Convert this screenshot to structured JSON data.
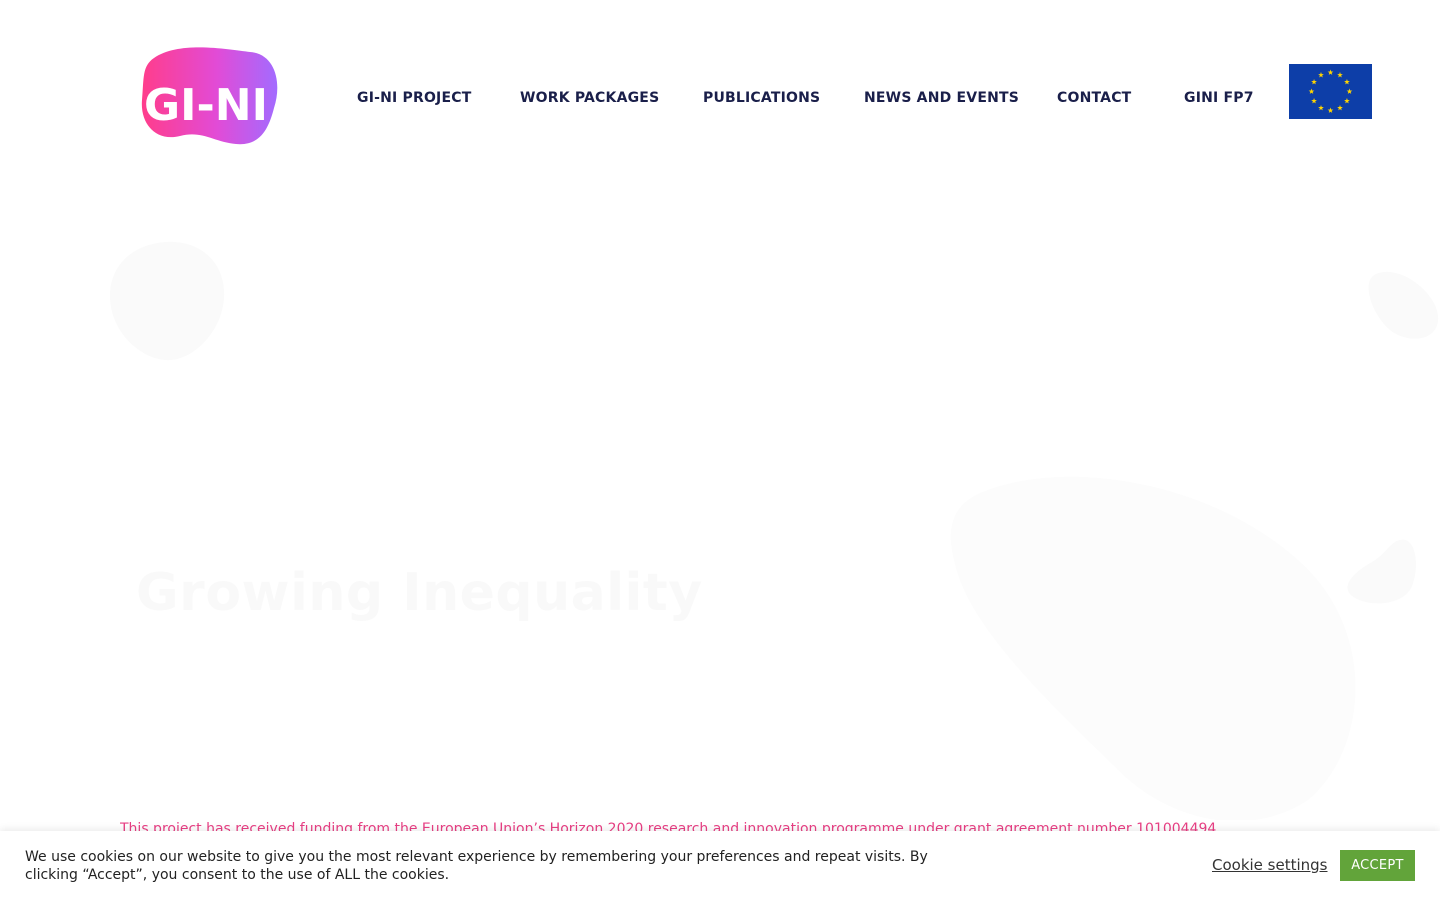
{
  "logo": {
    "text": "GI-NI"
  },
  "nav": {
    "items": [
      {
        "label": "GI-NI PROJECT"
      },
      {
        "label": "WORK PACKAGES"
      },
      {
        "label": "PUBLICATIONS"
      },
      {
        "label": "NEWS AND EVENTS"
      },
      {
        "label": "CONTACT"
      },
      {
        "label": "GINI FP7"
      }
    ]
  },
  "hero": {
    "title": "Growing Inequality"
  },
  "funding": {
    "text": "This project has received funding from the European Union’s Horizon 2020 research and innovation programme under grant agreement number 101004494"
  },
  "cookie": {
    "message": "We use cookies on our website to give you the most relevant experience by remembering your preferences and repeat visits. By clicking “Accept”, you consent to the use of ALL the cookies.",
    "settings_label": "Cookie settings",
    "accept_label": "ACCEPT"
  },
  "colors": {
    "nav_text": "#1a1f4a",
    "eu_blue": "#0d3ea8",
    "eu_star": "#ffd500",
    "funding_text": "#e83f84",
    "accept_button": "#62a43a",
    "logo_pink": "#ff3d8b",
    "logo_purple": "#a36bff"
  }
}
